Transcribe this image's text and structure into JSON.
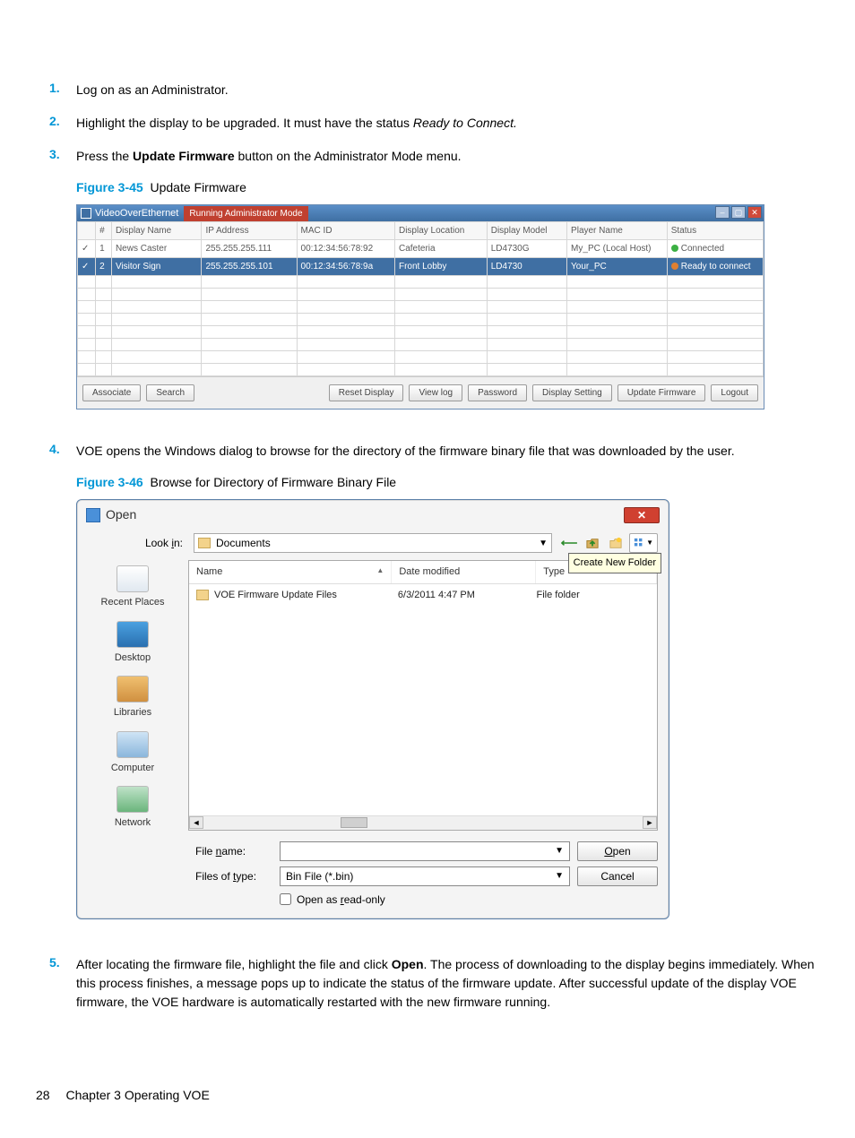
{
  "steps": {
    "s1": {
      "num": "1.",
      "text": "Log on as an Administrator."
    },
    "s2": {
      "num": "2.",
      "prefix": "Highlight the display to be upgraded. It must have the status ",
      "italic": "Ready to Connect."
    },
    "s3": {
      "num": "3.",
      "prefix": "Press the ",
      "bold": "Update Firmware",
      "suffix": " button on the Administrator Mode menu."
    },
    "s4": {
      "num": "4.",
      "text": "VOE opens the Windows dialog to browse for the directory of the firmware binary file that was downloaded by the user."
    },
    "s5": {
      "num": "5.",
      "prefix": "After locating the firmware file, highlight the file and click ",
      "bold": "Open",
      "suffix": ". The process of downloading to the display begins immediately. When this process finishes, a message pops up to indicate the status of the firmware update. After successful update of the display VOE firmware, the VOE hardware is automatically restarted with the new firmware running."
    }
  },
  "fig45": {
    "label": "Figure 3-45",
    "caption": "Update Firmware",
    "title": "VideoOverEthernet",
    "badge": "Running Administrator Mode",
    "headers": {
      "chk": "",
      "idx": "#",
      "name": "Display Name",
      "ip": "IP Address",
      "mac": "MAC ID",
      "loc": "Display Location",
      "model": "Display Model",
      "player": "Player Name",
      "status": "Status"
    },
    "rows": [
      {
        "chk": "✓",
        "idx": "1",
        "name": "News Caster",
        "ip": "255.255.255.111",
        "mac": "00:12:34:56:78:92",
        "loc": "Cafeteria",
        "model": "LD4730G",
        "player": "My_PC (Local Host)",
        "status": "Connected",
        "dot": "green",
        "selected": false
      },
      {
        "chk": "✓",
        "idx": "2",
        "name": "Visitor Sign",
        "ip": "255.255.255.101",
        "mac": "00:12:34:56:78:9a",
        "loc": "Front Lobby",
        "model": "LD4730",
        "player": "Your_PC",
        "status": "Ready to connect",
        "dot": "orange",
        "selected": true
      }
    ],
    "buttons": {
      "associate": "Associate",
      "search": "Search",
      "reset": "Reset Display",
      "viewlog": "View log",
      "password": "Password",
      "dispset": "Display Setting",
      "update": "Update Firmware",
      "logout": "Logout"
    }
  },
  "fig46": {
    "label": "Figure 3-46",
    "caption": "Browse for Directory of Firmware Binary File",
    "title": "Open",
    "lookin_label": "Look in:",
    "lookin_value": "Documents",
    "tooltip": "Create New Folder",
    "columns": {
      "name": "Name",
      "date": "Date modified",
      "type": "Type"
    },
    "row": {
      "name": "VOE Firmware Update Files",
      "date": "6/3/2011 4:47 PM",
      "type": "File folder"
    },
    "places": {
      "recent": "Recent Places",
      "desktop": "Desktop",
      "libraries": "Libraries",
      "computer": "Computer",
      "network": "Network"
    },
    "filename_label": "File name:",
    "filename_value": "",
    "filesoftype_label": "Files of type:",
    "filesoftype_value": "Bin File (*.bin)",
    "readonly_label": "Open as read-only",
    "open_btn": "Open",
    "cancel_btn": "Cancel"
  },
  "footer": {
    "page": "28",
    "chapter": "Chapter 3   Operating VOE"
  }
}
